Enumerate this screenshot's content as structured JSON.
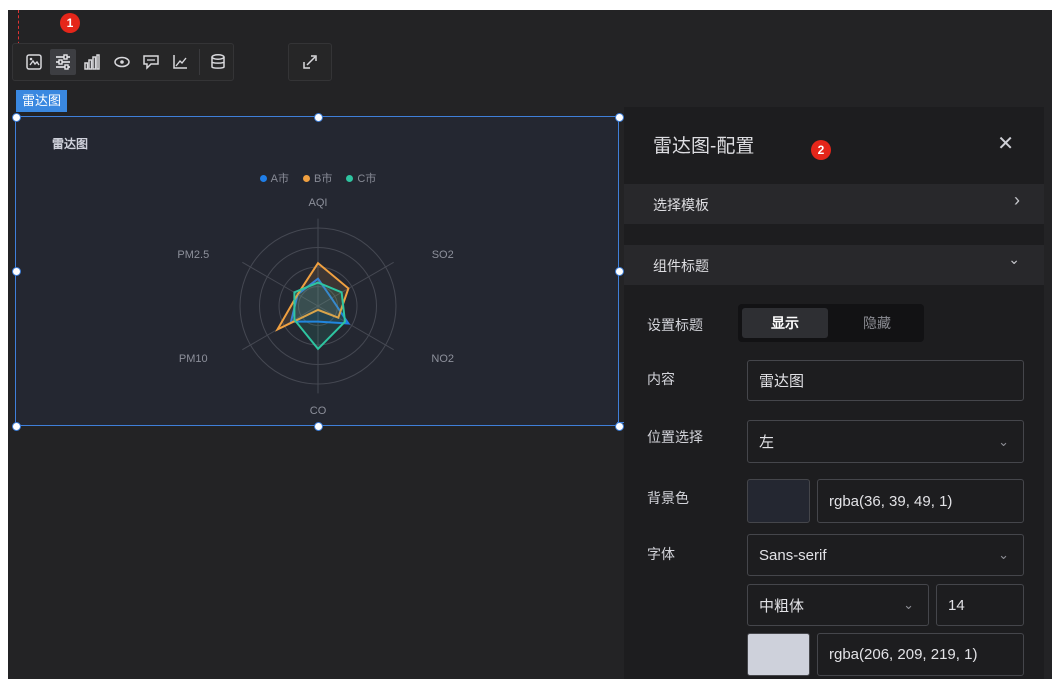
{
  "toolbar": {
    "step_badge": "1",
    "icons": [
      "image-icon",
      "sliders-icon",
      "bar-chart-icon",
      "eye-icon",
      "message-icon",
      "axis-icon",
      "database-icon",
      "share-icon"
    ],
    "active_icon": "sliders-icon"
  },
  "component": {
    "tag_label": "雷达图",
    "title": "雷达图",
    "legend": [
      {
        "name": "A市",
        "color": "#1f7ee8"
      },
      {
        "name": "B市",
        "color": "#f0a040"
      },
      {
        "name": "C市",
        "color": "#2ec4a0"
      }
    ]
  },
  "chart_data": {
    "type": "radar",
    "title": "雷达图",
    "indicators": [
      "AQI",
      "SO2",
      "NO2",
      "CO",
      "PM10",
      "PM2.5"
    ],
    "series": [
      {
        "name": "A市",
        "color": "#1f7ee8",
        "values": [
          0.35,
          0.2,
          0.45,
          0.2,
          0.4,
          0.3
        ]
      },
      {
        "name": "B市",
        "color": "#f0a040",
        "values": [
          0.55,
          0.45,
          0.3,
          0.05,
          0.6,
          0.3
        ]
      },
      {
        "name": "C市",
        "color": "#2ec4a0",
        "values": [
          0.3,
          0.35,
          0.4,
          0.55,
          0.35,
          0.35
        ]
      }
    ]
  },
  "panel": {
    "step_badge": "2",
    "title": "雷达图-配置",
    "close_glyph": "✕",
    "sections": {
      "template_label": "选择模板",
      "template_chevron": "›",
      "title_section_label": "组件标题",
      "title_section_chevron": "⌄"
    },
    "fields": {
      "set_title_label": "设置标题",
      "show_label": "显示",
      "hide_label": "隐藏",
      "content_label": "内容",
      "content_value": "雷达图",
      "position_label": "位置选择",
      "position_value": "左",
      "bg_label": "背景色",
      "bg_value": "rgba(36, 39, 49, 1)",
      "bg_color": "#242731",
      "font_label": "字体",
      "font_family_value": "Sans-serif",
      "font_weight_value": "中粗体",
      "font_size_value": "14",
      "font_color_value": "rgba(206, 209, 219, 1)",
      "font_color": "#ced1db",
      "select_arrow": "⌄"
    }
  }
}
